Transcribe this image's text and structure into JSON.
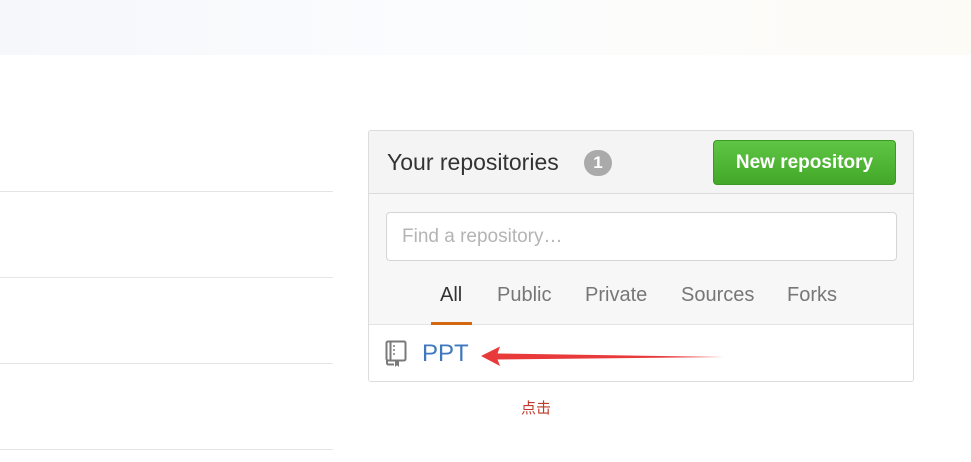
{
  "repositories": {
    "title": "Your repositories",
    "count": "1",
    "new_button_label": "New repository",
    "search_placeholder": "Find a repository…",
    "filter_tabs": [
      "All",
      "Public",
      "Private",
      "Sources",
      "Forks"
    ],
    "active_tab": "All",
    "items": [
      {
        "name": "PPT",
        "icon": "repo-book-icon"
      }
    ]
  },
  "annotation": {
    "text": "点击",
    "color": "#e8393b"
  },
  "colors": {
    "accent_green": "#55bb3a",
    "link_blue": "#4078c0",
    "tab_underline": "#d26911"
  }
}
